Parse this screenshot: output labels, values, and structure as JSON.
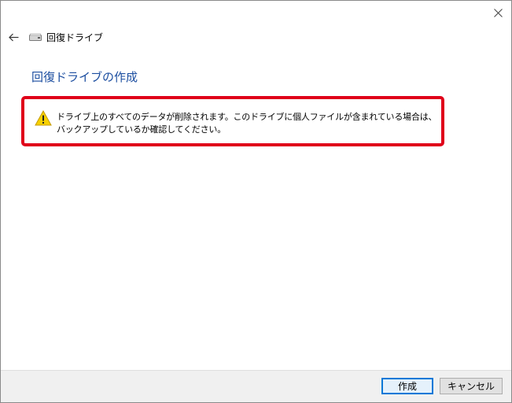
{
  "window": {
    "title": "回復ドライブ",
    "close_icon": "close-icon",
    "back_icon": "back-arrow-icon",
    "drive_icon": "drive-icon"
  },
  "main": {
    "heading": "回復ドライブの作成",
    "warning": {
      "icon": "warning-icon",
      "text": "ドライブ上のすべてのデータが削除されます。このドライブに個人ファイルが含まれている場合は、バックアップしているか確認してください。",
      "highlight_color": "#e0001a"
    }
  },
  "footer": {
    "create_label": "作成",
    "cancel_label": "キャンセル"
  },
  "colors": {
    "heading": "#1c4ea0",
    "default_button_border": "#0078d7",
    "footer_bg": "#f0f0f0"
  }
}
